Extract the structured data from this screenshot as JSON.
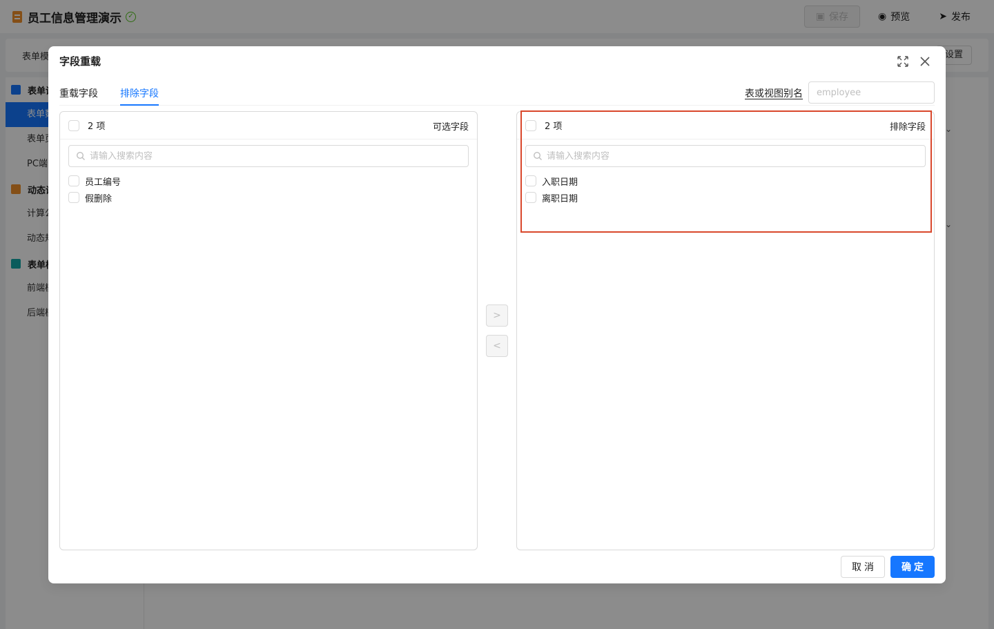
{
  "app": {
    "title": "员工信息管理演示",
    "save_label": "保存",
    "preview_label": "预览",
    "publish_label": "发布",
    "toolbar_left": "表单模",
    "toolbar_right": "设置"
  },
  "sidebar": {
    "groups": [
      {
        "label": "表单设",
        "color": "#1677ff",
        "items": [
          "表单数",
          "表单页",
          "PC端"
        ]
      },
      {
        "label": "动态设",
        "color": "#f0902b",
        "items": [
          "计算公",
          "动态规"
        ]
      },
      {
        "label": "表单模",
        "color": "#13a8a8",
        "items": [
          "前端模",
          "后端模"
        ]
      }
    ]
  },
  "modal": {
    "title": "字段重载",
    "tabs": [
      "重载字段",
      "排除字段"
    ],
    "active_tab": "排除字段",
    "alias_label": "表或视图别名",
    "alias_placeholder": "employee",
    "left_panel": {
      "count": "2 项",
      "title": "可选字段",
      "search_placeholder": "请输入搜索内容",
      "items": [
        "员工编号",
        "假删除"
      ]
    },
    "right_panel": {
      "count": "2 项",
      "title": "排除字段",
      "search_placeholder": "请输入搜索内容",
      "items": [
        "入职日期",
        "离职日期"
      ]
    },
    "move_right": ">",
    "move_left": "<",
    "cancel_label": "取消",
    "ok_label": "确定"
  },
  "colors": {
    "primary": "#1677ff",
    "highlight": "#d9472b"
  }
}
